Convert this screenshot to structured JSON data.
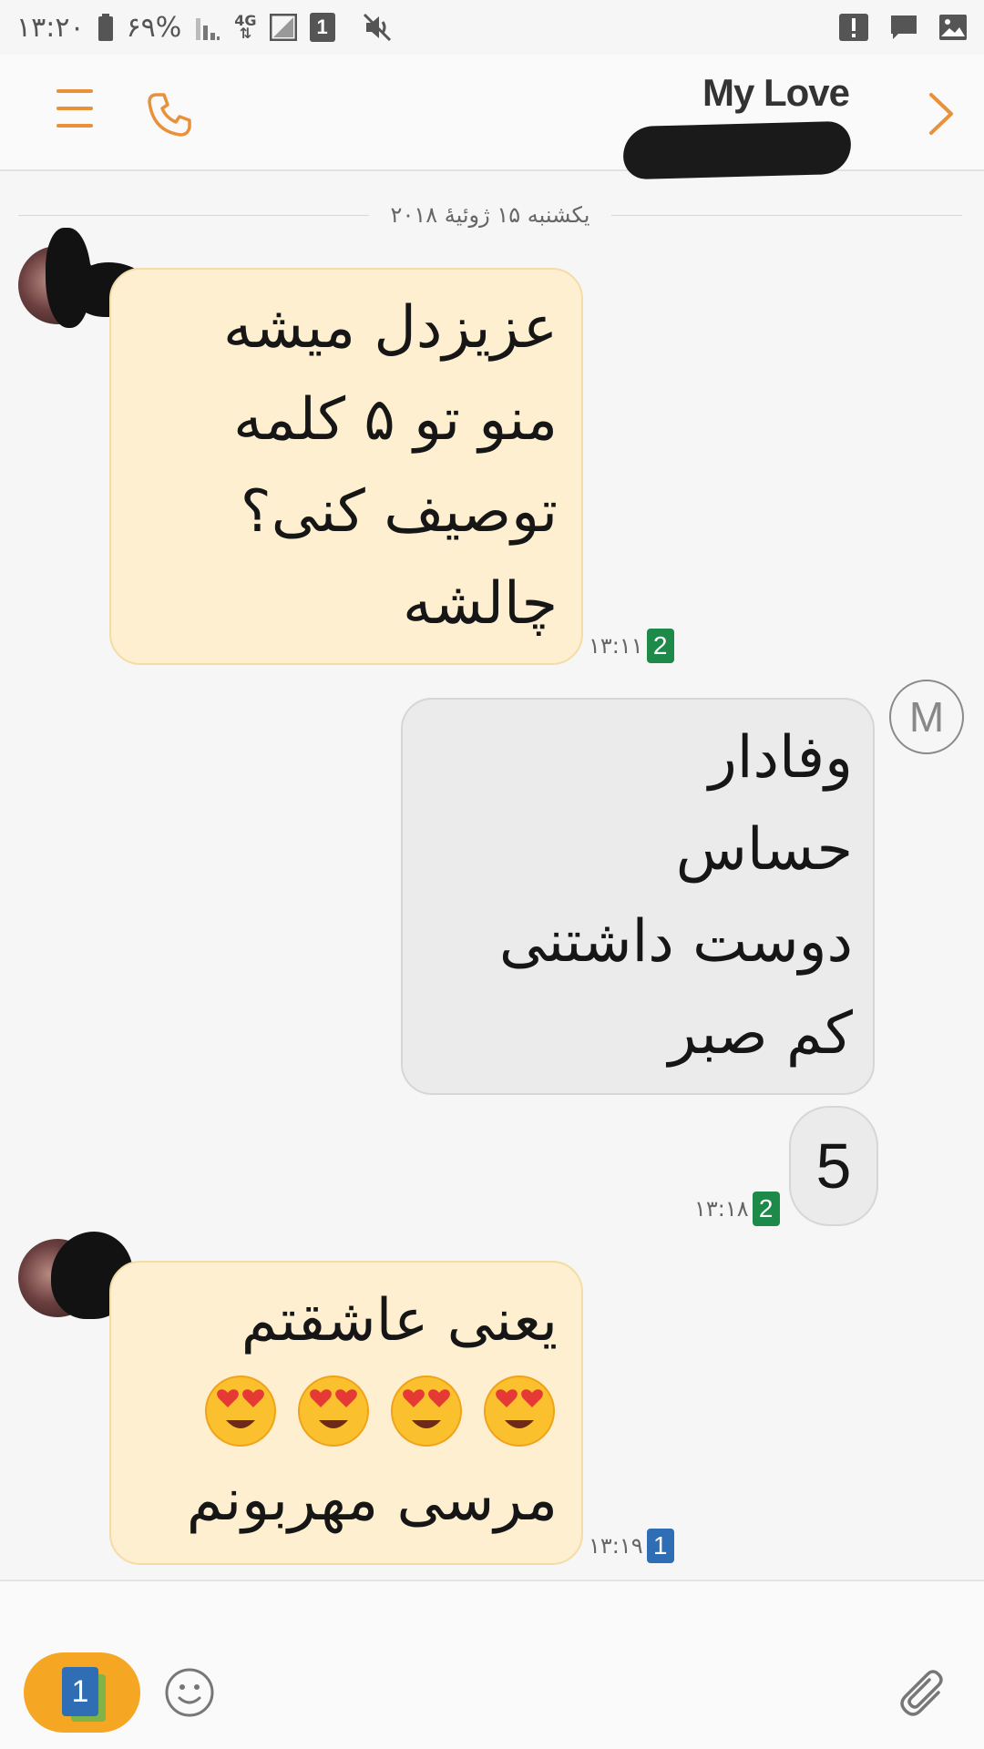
{
  "status_bar": {
    "time": "۱۳:۲۰",
    "battery": "۶۹%",
    "network": "4G",
    "sim_number": "1",
    "icons": [
      "battery-icon",
      "signal-icon",
      "data-4g-icon",
      "no-signal-icon",
      "sim-1-icon",
      "mute-icon",
      "alert-icon",
      "message-icon",
      "image-icon"
    ]
  },
  "header": {
    "contact_name": "My Love",
    "icons": [
      "menu-icon",
      "phone-icon",
      "chevron-right-icon"
    ],
    "accent_color": "#e8913a"
  },
  "conversation": {
    "date_label": "یکشنبه ۱۵ ژوئیهٔ ۲۰۱۸",
    "messages": [
      {
        "direction": "incoming",
        "lines": [
          "عزیزدل میشه",
          "منو تو ۵ کلمه",
          "توصیف کنی؟",
          "چالشه"
        ],
        "time": "۱۳:۱۱",
        "sim": "2"
      },
      {
        "direction": "outgoing",
        "lines": [
          "وفادار",
          "حساس",
          "دوست داشتنی",
          "کم صبر"
        ],
        "sender_initial": "M"
      },
      {
        "direction": "outgoing",
        "lines": [
          "5"
        ],
        "time": "۱۳:۱۸",
        "sim": "2"
      },
      {
        "direction": "incoming",
        "lines": [
          "یعنی عاشقتم",
          "مرسی مهربونم"
        ],
        "emoji": "heart-eyes-emoji",
        "emoji_count": 4,
        "time": "۱۳:۱۹",
        "sim": "1"
      }
    ]
  },
  "composer": {
    "sim_selected": "1",
    "sim_button_color": "#f5a623",
    "icons": [
      "sim-card-icon",
      "emoji-icon",
      "paperclip-icon"
    ]
  }
}
